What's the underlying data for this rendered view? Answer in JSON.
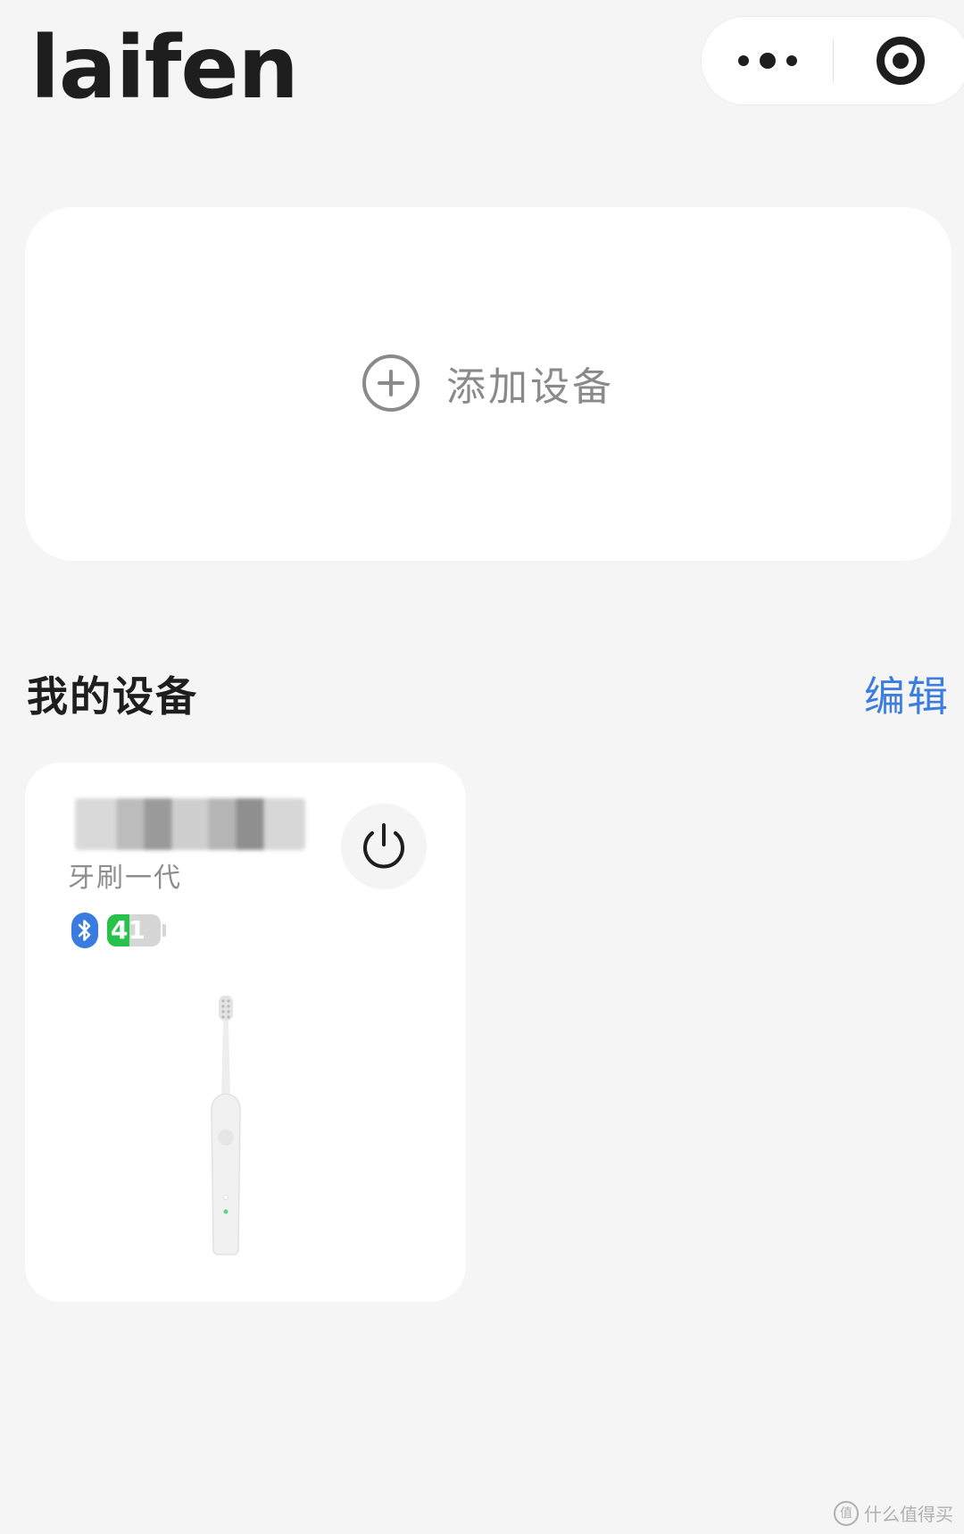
{
  "header": {
    "logo_text": "laifen",
    "more_icon": "more-dots-icon",
    "close_icon": "target-circle-icon"
  },
  "add_device": {
    "label": "添加设备",
    "icon": "plus-circle-icon"
  },
  "my_devices": {
    "title": "我的设备",
    "edit_label": "编辑",
    "accent_color": "#3c7de0",
    "devices": [
      {
        "name": "",
        "model": "牙刷一代",
        "bluetooth_icon": "bluetooth-icon",
        "battery_level": "41",
        "battery_fraction": 0.41,
        "battery_color": "#27c24c",
        "power_icon": "power-icon",
        "image": "toothbrush-image"
      }
    ]
  },
  "watermark": {
    "text": "什么值得买"
  }
}
